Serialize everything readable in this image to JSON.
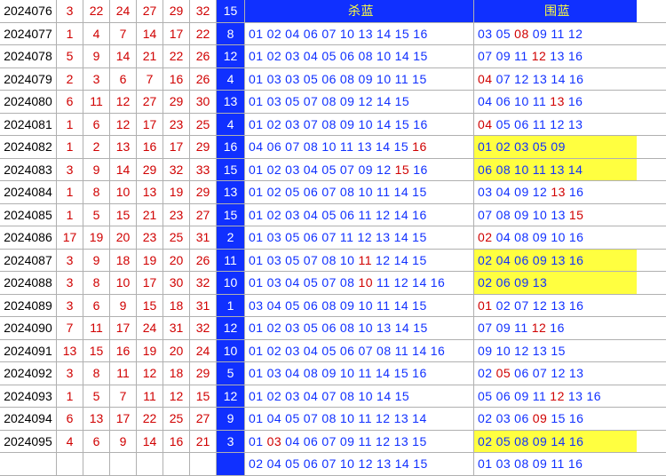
{
  "headers": {
    "kill": "杀蓝",
    "wei": "围蓝"
  },
  "rows": [
    {
      "period": "2024076",
      "reds": [
        "3",
        "22",
        "24",
        "27",
        "29",
        "32"
      ],
      "blue": "15",
      "kill": [],
      "wei": [],
      "wei_hl": false
    },
    {
      "period": "2024077",
      "reds": [
        "1",
        "4",
        "7",
        "14",
        "17",
        "22"
      ],
      "blue": "8",
      "kill": [
        "01",
        "02",
        "04",
        "06",
        "07",
        "10",
        "13",
        "14",
        "15",
        "16"
      ],
      "wei": [
        "03",
        "05",
        "08",
        "09",
        "11",
        "12"
      ],
      "wei_hl": false,
      "wei_red": [
        "08"
      ]
    },
    {
      "period": "2024078",
      "reds": [
        "5",
        "9",
        "14",
        "21",
        "22",
        "26"
      ],
      "blue": "12",
      "kill": [
        "01",
        "02",
        "03",
        "04",
        "05",
        "06",
        "08",
        "10",
        "14",
        "15"
      ],
      "wei": [
        "07",
        "09",
        "11",
        "12",
        "13",
        "16"
      ],
      "wei_hl": false,
      "wei_red": [
        "12"
      ]
    },
    {
      "period": "2024079",
      "reds": [
        "2",
        "3",
        "6",
        "7",
        "16",
        "26"
      ],
      "blue": "4",
      "kill": [
        "01",
        "03",
        "03",
        "05",
        "06",
        "08",
        "09",
        "10",
        "11",
        "15"
      ],
      "wei": [
        "04",
        "07",
        "12",
        "13",
        "14",
        "16"
      ],
      "wei_hl": false,
      "wei_red": [
        "04"
      ]
    },
    {
      "period": "2024080",
      "reds": [
        "6",
        "11",
        "12",
        "27",
        "29",
        "30"
      ],
      "blue": "13",
      "kill": [
        "01",
        "03",
        "05",
        "07",
        "08",
        "09",
        "12",
        "14",
        "15"
      ],
      "wei": [
        "04",
        "06",
        "10",
        "11",
        "13",
        "16"
      ],
      "wei_hl": false,
      "wei_red": [
        "13"
      ]
    },
    {
      "period": "2024081",
      "reds": [
        "1",
        "6",
        "12",
        "17",
        "23",
        "25"
      ],
      "blue": "4",
      "kill": [
        "01",
        "02",
        "03",
        "07",
        "08",
        "09",
        "10",
        "14",
        "15",
        "16"
      ],
      "wei": [
        "04",
        "05",
        "06",
        "11",
        "12",
        "13"
      ],
      "wei_hl": false,
      "wei_red": [
        "04"
      ]
    },
    {
      "period": "2024082",
      "reds": [
        "1",
        "2",
        "13",
        "16",
        "17",
        "29"
      ],
      "blue": "16",
      "kill": [
        "04",
        "06",
        "07",
        "08",
        "10",
        "11",
        "13",
        "14",
        "15",
        "16"
      ],
      "kill_red": [
        "16"
      ],
      "wei": [
        "01",
        "02",
        "03",
        "05",
        "09"
      ],
      "wei_hl": true
    },
    {
      "period": "2024083",
      "reds": [
        "3",
        "9",
        "14",
        "29",
        "32",
        "33"
      ],
      "blue": "15",
      "kill": [
        "01",
        "02",
        "03",
        "04",
        "05",
        "07",
        "09",
        "12",
        "15",
        "16"
      ],
      "kill_red": [
        "15"
      ],
      "wei": [
        "06",
        "08",
        "10",
        "11",
        "13",
        "14"
      ],
      "wei_hl": true
    },
    {
      "period": "2024084",
      "reds": [
        "1",
        "8",
        "10",
        "13",
        "19",
        "29"
      ],
      "blue": "13",
      "kill": [
        "01",
        "02",
        "05",
        "06",
        "07",
        "08",
        "10",
        "11",
        "14",
        "15"
      ],
      "wei": [
        "03",
        "04",
        "09",
        "12",
        "13",
        "16"
      ],
      "wei_hl": false,
      "wei_red": [
        "13"
      ]
    },
    {
      "period": "2024085",
      "reds": [
        "1",
        "5",
        "15",
        "21",
        "23",
        "27"
      ],
      "blue": "15",
      "kill": [
        "01",
        "02",
        "03",
        "04",
        "05",
        "06",
        "11",
        "12",
        "14",
        "16"
      ],
      "wei": [
        "07",
        "08",
        "09",
        "10",
        "13",
        "15"
      ],
      "wei_hl": false,
      "wei_red": [
        "15"
      ]
    },
    {
      "period": "2024086",
      "reds": [
        "17",
        "19",
        "20",
        "23",
        "25",
        "31"
      ],
      "blue": "2",
      "kill": [
        "01",
        "03",
        "05",
        "06",
        "07",
        "11",
        "12",
        "13",
        "14",
        "15"
      ],
      "wei": [
        "02",
        "04",
        "08",
        "09",
        "10",
        "16"
      ],
      "wei_hl": false,
      "wei_red": [
        "02"
      ]
    },
    {
      "period": "2024087",
      "reds": [
        "3",
        "9",
        "18",
        "19",
        "20",
        "26"
      ],
      "blue": "11",
      "kill": [
        "01",
        "03",
        "05",
        "07",
        "08",
        "10",
        "11",
        "12",
        "14",
        "15"
      ],
      "kill_red": [
        "11"
      ],
      "wei": [
        "02",
        "04",
        "06",
        "09",
        "13",
        "16"
      ],
      "wei_hl": true
    },
    {
      "period": "2024088",
      "reds": [
        "3",
        "8",
        "10",
        "17",
        "30",
        "32"
      ],
      "blue": "10",
      "kill": [
        "01",
        "03",
        "04",
        "05",
        "07",
        "08",
        "10",
        "11",
        "12",
        "14",
        "16"
      ],
      "kill_red": [
        "10"
      ],
      "wei": [
        "02",
        "06",
        "09",
        "13"
      ],
      "wei_hl": true
    },
    {
      "period": "2024089",
      "reds": [
        "3",
        "6",
        "9",
        "15",
        "18",
        "31"
      ],
      "blue": "1",
      "kill": [
        "03",
        "04",
        "05",
        "06",
        "08",
        "09",
        "10",
        "11",
        "14",
        "15"
      ],
      "wei": [
        "01",
        "02",
        "07",
        "12",
        "13",
        "16"
      ],
      "wei_hl": false,
      "wei_red": [
        "01"
      ]
    },
    {
      "period": "2024090",
      "reds": [
        "7",
        "11",
        "17",
        "24",
        "31",
        "32"
      ],
      "blue": "12",
      "kill": [
        "01",
        "02",
        "03",
        "05",
        "06",
        "08",
        "10",
        "13",
        "14",
        "15"
      ],
      "wei": [
        "07",
        "09",
        "11",
        "12",
        "16"
      ],
      "wei_hl": false,
      "wei_red": [
        "12"
      ]
    },
    {
      "period": "2024091",
      "reds": [
        "13",
        "15",
        "16",
        "19",
        "20",
        "24"
      ],
      "blue": "10",
      "kill": [
        "01",
        "02",
        "03",
        "04",
        "05",
        "06",
        "07",
        "08",
        "11",
        "14",
        "16"
      ],
      "wei": [
        "09",
        "10",
        "12",
        "13",
        "15"
      ],
      "wei_hl": false
    },
    {
      "period": "2024092",
      "reds": [
        "3",
        "8",
        "11",
        "12",
        "18",
        "29"
      ],
      "blue": "5",
      "kill": [
        "01",
        "03",
        "04",
        "08",
        "09",
        "10",
        "11",
        "14",
        "15",
        "16"
      ],
      "wei": [
        "02",
        "05",
        "06",
        "07",
        "12",
        "13"
      ],
      "wei_hl": false,
      "wei_red": [
        "05"
      ]
    },
    {
      "period": "2024093",
      "reds": [
        "1",
        "5",
        "7",
        "11",
        "12",
        "15"
      ],
      "blue": "12",
      "kill": [
        "01",
        "02",
        "03",
        "04",
        "07",
        "08",
        "10",
        "14",
        "15"
      ],
      "wei": [
        "05",
        "06",
        "09",
        "11",
        "12",
        "13",
        "16"
      ],
      "wei_hl": false,
      "wei_red": [
        "12"
      ]
    },
    {
      "period": "2024094",
      "reds": [
        "6",
        "13",
        "17",
        "22",
        "25",
        "27"
      ],
      "blue": "9",
      "kill": [
        "01",
        "04",
        "05",
        "07",
        "08",
        "10",
        "11",
        "12",
        "13",
        "14"
      ],
      "wei": [
        "02",
        "03",
        "06",
        "09",
        "15",
        "16"
      ],
      "wei_hl": false,
      "wei_red": [
        "09"
      ]
    },
    {
      "period": "2024095",
      "reds": [
        "4",
        "6",
        "9",
        "14",
        "16",
        "21"
      ],
      "blue": "3",
      "kill": [
        "01",
        "03",
        "04",
        "06",
        "07",
        "09",
        "11",
        "12",
        "13",
        "15"
      ],
      "kill_red": [
        "03"
      ],
      "wei": [
        "02",
        "05",
        "08",
        "09",
        "14",
        "16"
      ],
      "wei_hl": true
    },
    {
      "period": "",
      "reds": [
        "",
        "",
        "",
        "",
        "",
        ""
      ],
      "blue": "",
      "kill": [
        "02",
        "04",
        "05",
        "06",
        "07",
        "10",
        "12",
        "13",
        "14",
        "15"
      ],
      "wei": [
        "01",
        "03",
        "08",
        "09",
        "11",
        "16"
      ],
      "wei_hl": false
    }
  ]
}
